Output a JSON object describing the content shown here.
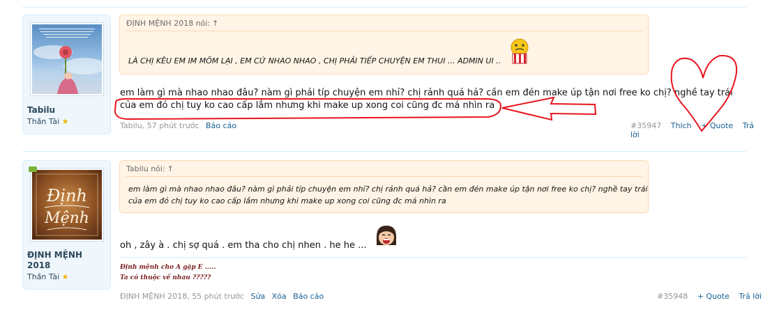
{
  "posts": [
    {
      "username": "Tabilu",
      "user_title": "Thần Tài",
      "quote_header": "ĐỊNH MỆNH 2018 nói:",
      "quote_arrow": "↑",
      "quote_text": "LÀ CHỊ KÊU EM IM MÕM LẠI , EM CỨ NHAO NHAO , CHỊ PHẢI TIẾP CHUYỆN EM THUI ... ADMIN UI ..",
      "message_line1": "em làm gì mà nhao nhao đâu? nàm gì phải típ chuyện em nhỉ? chị rảnh quá hả? cần em đén make úp tận nơi free ko chị? nghề tay trái",
      "message_line2": "của em đó chị tuy ko cao cấp lắm nhưng khi make up xong coi cũng đc má nhìn ra",
      "meta_author_time": "Tabilu, 57 phút trước",
      "report": "Báo cáo",
      "post_number": "#35947",
      "like": "Thích",
      "quote": "+ Quote",
      "reply": "Trả lời"
    },
    {
      "username": "ĐỊNH MỆNH 2018",
      "user_title": "Thần Tài",
      "avatar_text_1": "Định",
      "avatar_text_2": "Mệnh",
      "quote_header": "Tabilu nói:",
      "quote_arrow": "↑",
      "quote_line1": "em làm gì mà nhao nhao đâu? nàm gì phải típ chuyện em nhỉ? chị rảnh quá hả? cần em đén make úp tận nơi free ko chị? nghề tay trái",
      "quote_line2": "của em đó chị tuy ko cao cấp lắm nhưng khi make up xong coi cũng đc má nhìn ra",
      "message": "oh , zây à . chị sợ quá . em tha cho chị nhen . he he ...",
      "sig_line1": "Định mệnh cho A gặp E .....",
      "sig_line2": "Ta có thuộc về nhau ?????",
      "meta_author_time": "ĐỊNH MỆNH 2018, 55 phút trước",
      "edit": "Sửa",
      "delete": "Xóa",
      "report": "Báo cáo",
      "post_number": "#35948",
      "quote": "+ Quote",
      "reply": "Trả lời"
    }
  ],
  "colors": {
    "link": "#176093",
    "annotation_red": "#e8141e",
    "quote_bg": "#fff4e5",
    "userbox_bg": "#f0f7fc"
  },
  "icons": [
    "star-icon",
    "popcorn-smiley-icon",
    "laughing-girl-smiley-icon",
    "heart-drawing",
    "arrow-drawing"
  ]
}
